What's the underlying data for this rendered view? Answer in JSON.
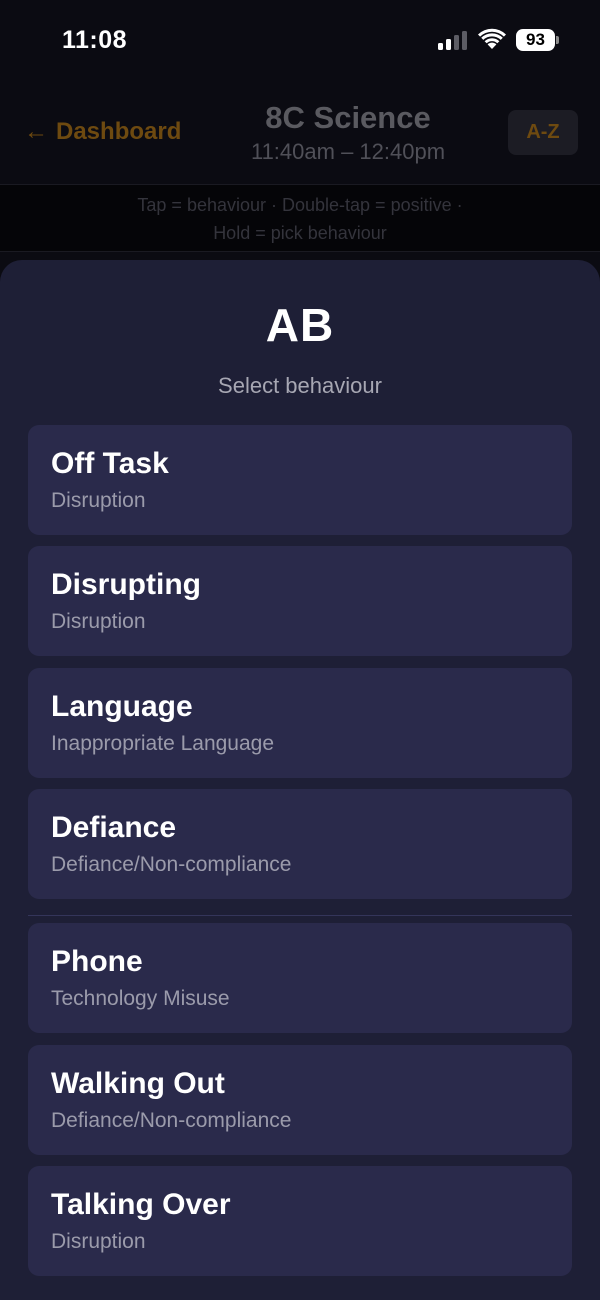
{
  "status_bar": {
    "time": "11:08",
    "battery": "93",
    "icons": [
      "cellular-signal-icon",
      "wifi-icon",
      "battery-icon"
    ]
  },
  "header": {
    "back_label": "Dashboard",
    "back_icon": "arrow-left-icon",
    "class_name": "8C Science",
    "class_time": "11:40am – 12:40pm",
    "sort_label": "A-Z",
    "accent_color": "#6e4a10"
  },
  "hint": {
    "line1": "Tap = behaviour · Double-tap = positive ·",
    "line2": "Hold = pick behaviour"
  },
  "sheet": {
    "student": "AB",
    "subtitle": "Select behaviour",
    "options": [
      {
        "title": "Off Task",
        "category": "Disruption"
      },
      {
        "title": "Disrupting",
        "category": "Disruption"
      },
      {
        "title": "Language",
        "category": "Inappropriate Language"
      },
      {
        "title": "Defiance",
        "category": "Defiance/Non-compliance"
      },
      {
        "title": "Phone",
        "category": "Technology Misuse"
      },
      {
        "title": "Walking Out",
        "category": "Defiance/Non-compliance"
      },
      {
        "title": "Talking Over",
        "category": "Disruption"
      }
    ]
  }
}
